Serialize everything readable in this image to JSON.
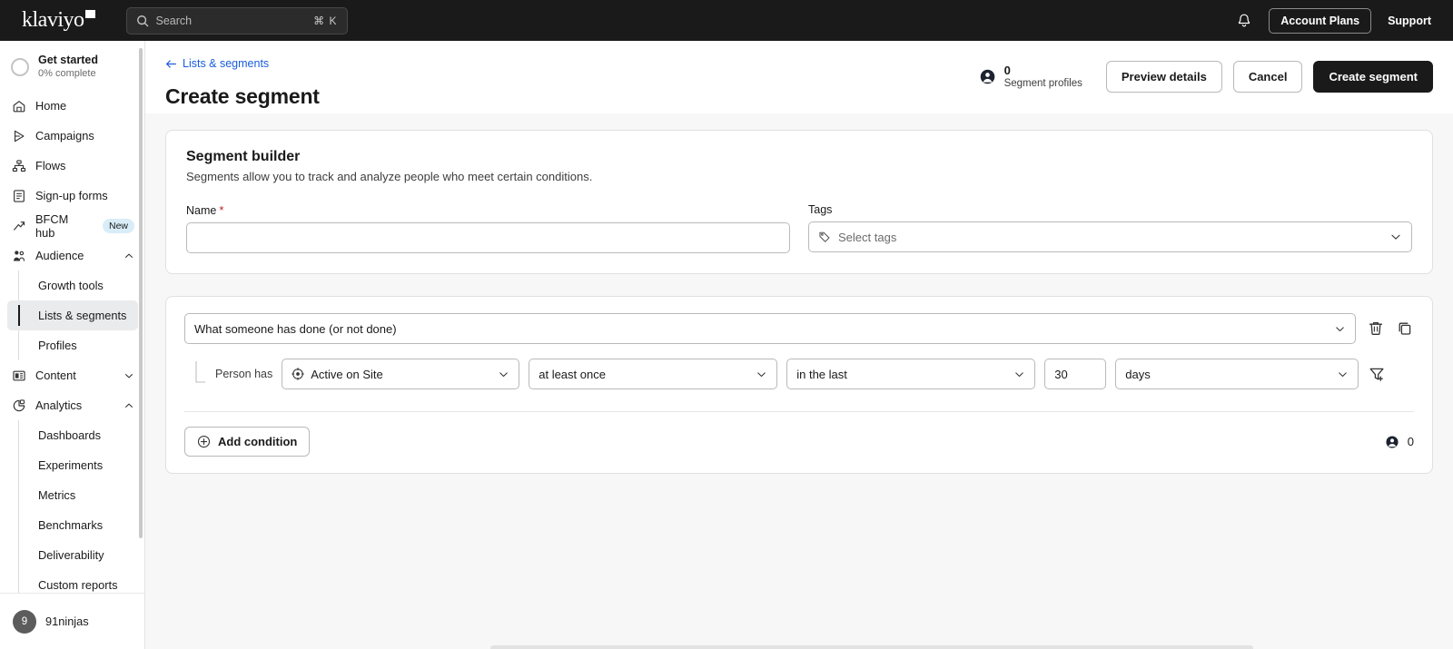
{
  "topbar": {
    "logo_text": "klaviyo",
    "search_placeholder": "Search",
    "search_shortcut": "⌘ K",
    "bell_icon": "notification-bell-icon",
    "account_plans_label": "Account Plans",
    "support_label": "Support"
  },
  "sidebar": {
    "get_started": {
      "title": "Get started",
      "progress_label": "0% complete"
    },
    "items": [
      {
        "label": "Home",
        "icon": "home-icon"
      },
      {
        "label": "Campaigns",
        "icon": "send-icon"
      },
      {
        "label": "Flows",
        "icon": "flow-icon"
      },
      {
        "label": "Sign-up forms",
        "icon": "form-icon"
      },
      {
        "label": "BFCM hub",
        "icon": "trending-up-icon",
        "badge": "New"
      },
      {
        "label": "Audience",
        "icon": "audience-icon",
        "expanded": true
      },
      {
        "label": "Content",
        "icon": "content-icon",
        "expanded": false
      },
      {
        "label": "Analytics",
        "icon": "analytics-icon",
        "expanded": true
      }
    ],
    "audience_children": [
      {
        "label": "Growth tools",
        "active": false
      },
      {
        "label": "Lists & segments",
        "active": true
      },
      {
        "label": "Profiles",
        "active": false
      }
    ],
    "analytics_children": [
      {
        "label": "Dashboards",
        "active": false
      },
      {
        "label": "Experiments",
        "active": false
      },
      {
        "label": "Metrics",
        "active": false
      },
      {
        "label": "Benchmarks",
        "active": false
      },
      {
        "label": "Deliverability",
        "active": false
      },
      {
        "label": "Custom reports",
        "active": false
      }
    ],
    "account": {
      "initial": "9",
      "name": "91ninjas"
    }
  },
  "page": {
    "breadcrumb": "Lists & segments",
    "back_icon": "arrow-left-icon",
    "title": "Create segment",
    "profiles_icon": "person-circle-icon",
    "profiles_count": "0",
    "profiles_label": "Segment profiles",
    "preview_button": "Preview details",
    "cancel_button": "Cancel",
    "create_button": "Create segment"
  },
  "builder": {
    "title": "Segment builder",
    "subtitle": "Segments allow you to track and analyze people who meet certain conditions.",
    "name_label": "Name",
    "name_required": "*",
    "name_value": "",
    "tags_label": "Tags",
    "tags_icon": "tag-icon",
    "tags_placeholder": "Select tags",
    "tags_chevron": "chevron-down-icon"
  },
  "condition": {
    "type_value": "What someone has done (or not done)",
    "type_chevron": "chevron-down-icon",
    "delete_icon": "trash-icon",
    "duplicate_icon": "copy-icon",
    "person_has_label": "Person has",
    "metric_icon": "target-icon",
    "metric_value": "Active on Site",
    "frequency_value": "at least once",
    "timeframe_value": "in the last",
    "duration_value": "30",
    "unit_value": "days",
    "filter_icon": "filter-plus-icon",
    "add_condition_icon": "plus-circle-icon",
    "add_condition_label": "Add condition",
    "footer_icon": "person-circle-icon",
    "footer_count": "0"
  },
  "colors": {
    "topbar_bg": "#1a1a1a",
    "link_blue": "#1a5ddb",
    "required_red": "#c02026",
    "badge_blue": "#d9edf8",
    "canvas_gray": "#f7f7f7",
    "active_nav": "#e9ebed"
  }
}
